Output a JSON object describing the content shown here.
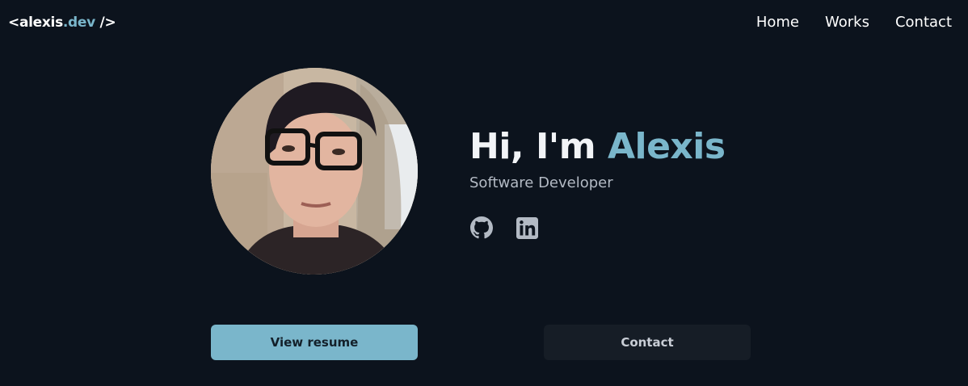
{
  "header": {
    "logo": {
      "open": "<alexis",
      "accent": ".dev",
      "close": " />"
    },
    "nav": [
      {
        "label": "Home"
      },
      {
        "label": "Works"
      },
      {
        "label": "Contact"
      }
    ]
  },
  "hero": {
    "greeting_prefix": "Hi, I'm ",
    "name": "Alexis",
    "role": "Software Developer",
    "socials": [
      {
        "icon": "github-icon"
      },
      {
        "icon": "linkedin-icon"
      }
    ]
  },
  "actions": {
    "resume_label": "View resume",
    "contact_label": "Contact"
  },
  "colors": {
    "background": "#0c131d",
    "accent": "#7ab6cb",
    "secondary_button": "#161d26"
  }
}
